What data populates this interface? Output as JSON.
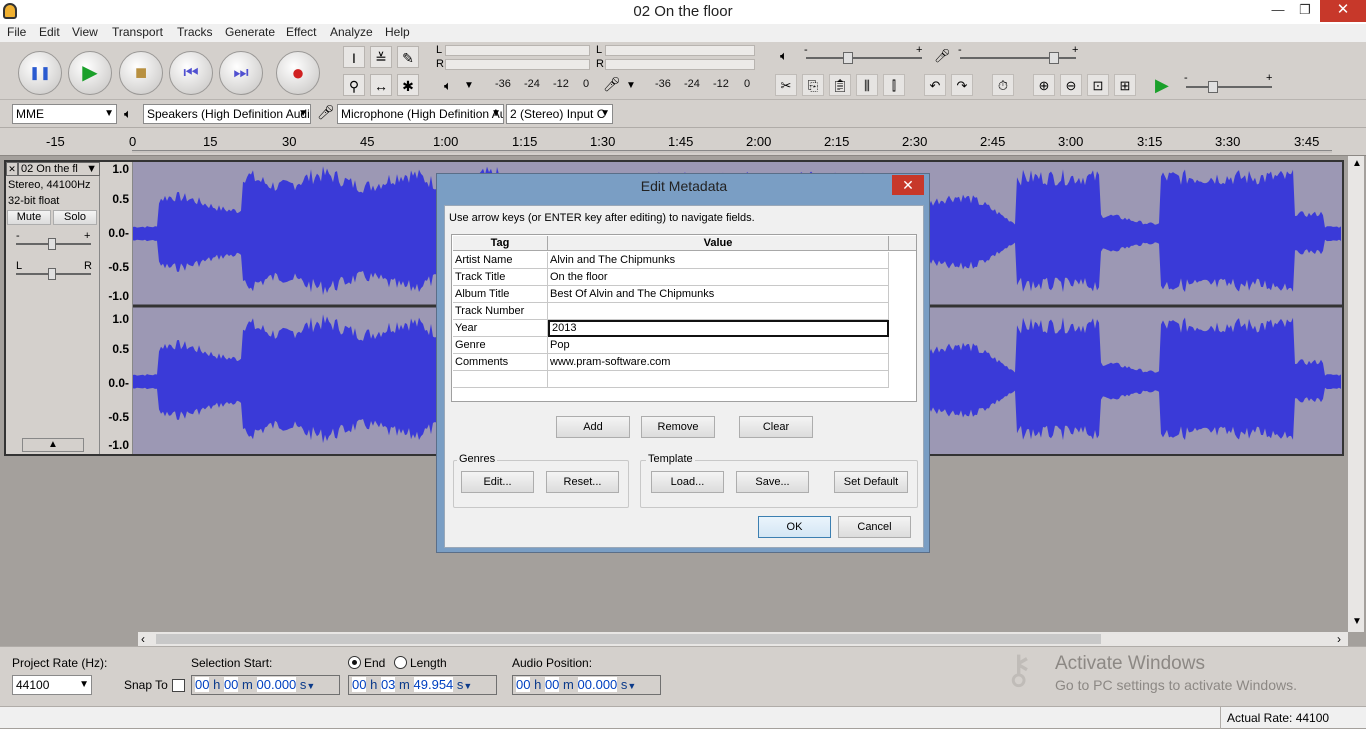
{
  "window": {
    "title": "02 On the floor",
    "minimize": "—",
    "restore": "❐",
    "close": "✕"
  },
  "menu": [
    "File",
    "Edit",
    "View",
    "Transport",
    "Tracks",
    "Generate",
    "Effect",
    "Analyze",
    "Help"
  ],
  "transport": {
    "pause": "❚❚",
    "play": "▶",
    "stop": "■",
    "skip_start": "⏮",
    "skip_end": "⏭",
    "record": "●"
  },
  "meters": {
    "channel_left": "L",
    "channel_right": "R",
    "playback_ticks": [
      "-36",
      "-24",
      "-12",
      "0"
    ],
    "record_ticks": [
      "-36",
      "-24",
      "-12",
      "0"
    ]
  },
  "mixer": {
    "minus": "-",
    "plus": "+"
  },
  "devices": {
    "host": "MME",
    "output": "Speakers (High Definition Audi",
    "input": "Microphone (High Definition Au",
    "channels": "2 (Stereo) Input C"
  },
  "ruler": [
    "-15",
    "0",
    "15",
    "30",
    "45",
    "1:00",
    "1:15",
    "1:30",
    "1:45",
    "2:00",
    "2:15",
    "2:30",
    "2:45",
    "3:00",
    "3:15",
    "3:30",
    "3:45"
  ],
  "track": {
    "name": "02 On the fl",
    "close": "✕",
    "dropdown": "▼",
    "info1": "Stereo, 44100Hz",
    "info2": "32-bit float",
    "mute": "Mute",
    "solo": "Solo",
    "gain_minus": "-",
    "gain_plus": "+",
    "pan_left": "L",
    "pan_right": "R",
    "collapse": "▲",
    "scale_top": [
      "1.0",
      "0.5",
      "0.0-",
      "-0.5",
      "-1.0"
    ],
    "scale_bottom": [
      "1.0",
      "0.5",
      "0.0-",
      "-0.5",
      "-1.0"
    ]
  },
  "dialog": {
    "title": "Edit Metadata",
    "close": "✕",
    "instructions": "Use arrow keys (or ENTER key after editing) to navigate fields.",
    "col_tag": "Tag",
    "col_value": "Value",
    "rows": [
      {
        "tag": "Artist Name",
        "value": "Alvin and The Chipmunks"
      },
      {
        "tag": "Track Title",
        "value": "On the floor"
      },
      {
        "tag": "Album Title",
        "value": "Best Of Alvin and The Chipmunks"
      },
      {
        "tag": "Track Number",
        "value": ""
      },
      {
        "tag": "Year",
        "value": "2013"
      },
      {
        "tag": "Genre",
        "value": "Pop"
      },
      {
        "tag": "Comments",
        "value": "www.pram-software.com"
      },
      {
        "tag": "",
        "value": ""
      }
    ],
    "add": "Add",
    "remove": "Remove",
    "clear": "Clear",
    "genres_label": "Genres",
    "genres_edit": "Edit...",
    "genres_reset": "Reset...",
    "template_label": "Template",
    "template_load": "Load...",
    "template_save": "Save...",
    "template_default": "Set Default",
    "ok": "OK",
    "cancel": "Cancel"
  },
  "bottom": {
    "project_rate_label": "Project Rate (Hz):",
    "project_rate": "44100",
    "snap_to": "Snap To",
    "selection_start_label": "Selection Start:",
    "end_label": "End",
    "length_label": "Length",
    "audio_position_label": "Audio Position:",
    "selection_start": [
      "00",
      "h",
      "00",
      "m",
      "00.000",
      "s"
    ],
    "end": [
      "00",
      "h",
      "03",
      "m",
      "49.954",
      "s"
    ],
    "audio_position": [
      "00",
      "h",
      "00",
      "m",
      "00.000",
      "s"
    ]
  },
  "watermark": {
    "line1": "Activate Windows",
    "line2": "Go to PC settings to activate Windows."
  },
  "status": {
    "actual_rate": "Actual Rate: 44100"
  },
  "colors": {
    "waveform": "#3a3ad8",
    "waveform_bg": "#9c98b4",
    "dialog_frame": "#7a9ec4",
    "close_red": "#c7382a"
  }
}
